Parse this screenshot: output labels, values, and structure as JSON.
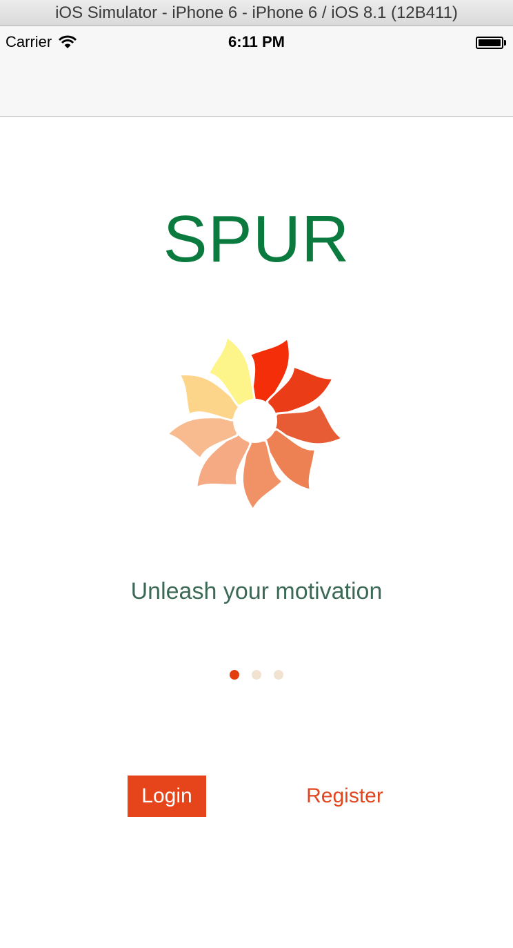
{
  "window": {
    "title": "iOS Simulator - iPhone 6 - iPhone 6 / iOS 8.1 (12B411)"
  },
  "status_bar": {
    "carrier": "Carrier",
    "time": "6:11 PM",
    "wifi_icon": "wifi-icon",
    "battery_icon": "battery-full-icon"
  },
  "app": {
    "title": "SPUR",
    "title_color": "#0b7a3e",
    "tagline": "Unleash your motivation",
    "logo_icon": "pinwheel-logo-icon"
  },
  "pager": {
    "count": 3,
    "active_index": 0,
    "active_color": "#e33e10"
  },
  "actions": {
    "login_label": "Login",
    "register_label": "Register",
    "accent": "#e6441a"
  }
}
